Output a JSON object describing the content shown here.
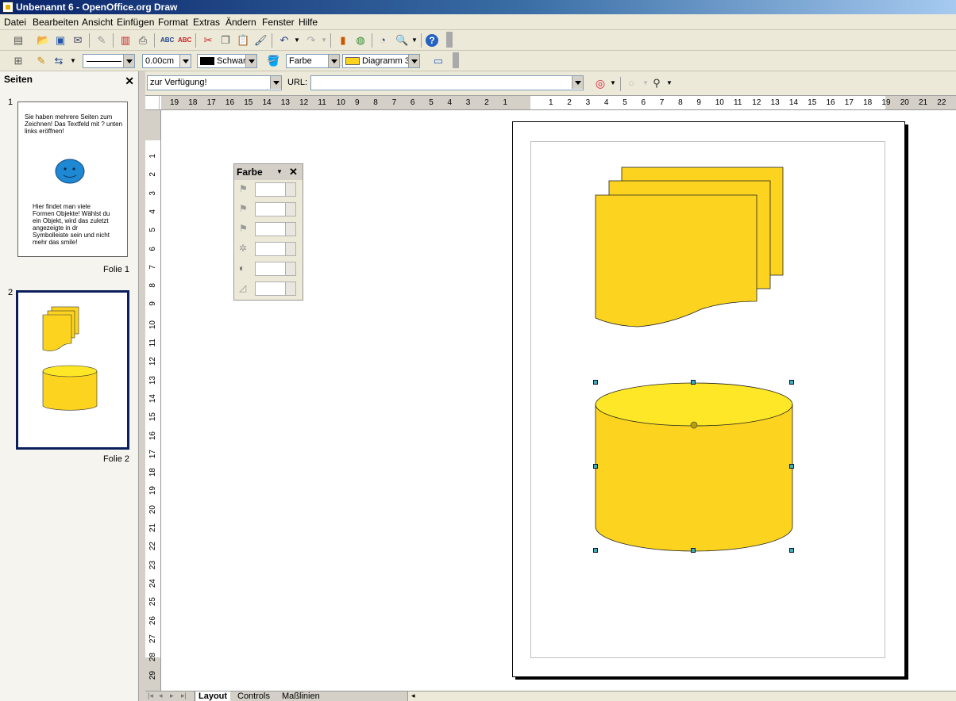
{
  "window": {
    "title": "Unbenannt 6 - OpenOffice.org Draw"
  },
  "menu": [
    "Datei",
    "Bearbeiten",
    "Ansicht",
    "Einfügen",
    "Format",
    "Extras",
    "Ändern",
    "Fenster",
    "Hilfe"
  ],
  "line_toolbar": {
    "width_value": "0.00cm",
    "line_color": "Schwar",
    "fill_type": "Farbe",
    "fill_color": "Diagramm 3"
  },
  "hyperlink_bar": {
    "target_value": "zur Verfügung!",
    "url_label": "URL:",
    "url_value": ""
  },
  "pages_panel": {
    "title": "Seiten",
    "slides": [
      {
        "number": "1",
        "label": "Folie 1",
        "text_top": "Sie haben mehrere Seiten zum Zeichnen! Das Textfeld mit ? unten links eröffnen!",
        "text_bottom": "Hier findet man viele Formen Objekte! Wählst du ein Objekt, wird das zuletzt angezeigte in dr Symbolleiste sein und nicht mehr das smile!"
      },
      {
        "number": "2",
        "label": "Folie 2"
      }
    ]
  },
  "color_toolbar": {
    "title": "Farbe"
  },
  "horizontal_ruler": {
    "left": [
      "19",
      "18",
      "17",
      "16",
      "15",
      "14",
      "13",
      "12",
      "11",
      "10",
      "9",
      "8",
      "7",
      "6",
      "5",
      "4",
      "3",
      "2",
      "1"
    ],
    "right": [
      "1",
      "2",
      "3",
      "4",
      "5",
      "6",
      "7",
      "8",
      "9",
      "10",
      "11",
      "12",
      "13",
      "14",
      "15",
      "16",
      "17",
      "18",
      "19",
      "20",
      "21",
      "22"
    ]
  },
  "vertical_ruler": [
    "1",
    "2",
    "3",
    "4",
    "5",
    "6",
    "7",
    "8",
    "9",
    "10",
    "11",
    "12",
    "13",
    "14",
    "15",
    "16",
    "17",
    "18",
    "19",
    "20",
    "21",
    "22",
    "23",
    "24",
    "25",
    "26",
    "27",
    "28",
    "29"
  ],
  "tabs": [
    "Layout",
    "Controls",
    "Maßlinien"
  ],
  "colors": {
    "shape_fill": "#fcd41f",
    "cylinder_top": "#fde726",
    "handle": "#3ab0b0",
    "selection_border": "#0a1f5c"
  }
}
